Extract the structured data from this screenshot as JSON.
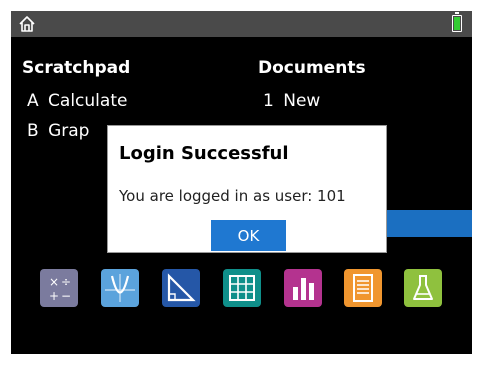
{
  "statusbar": {
    "home_icon": "home-icon",
    "battery_icon": "battery-icon",
    "battery_color": "#33cc33"
  },
  "scratchpad": {
    "heading": "Scratchpad",
    "items": [
      {
        "key": "A",
        "label": "Calculate"
      },
      {
        "key": "B",
        "label": "Grap"
      }
    ]
  },
  "documents": {
    "heading": "Documents",
    "items": [
      {
        "key": "1",
        "label": "New"
      }
    ]
  },
  "dialog": {
    "title": "Login Successful",
    "message": "You are logged in as user: 101",
    "ok_label": "OK"
  },
  "apps": [
    {
      "name": "calculator-icon",
      "color": "#7b7b9e"
    },
    {
      "name": "graphs-icon",
      "color": "#5ba3dc"
    },
    {
      "name": "geometry-icon",
      "color": "#2557a7"
    },
    {
      "name": "lists-spreadsheet-icon",
      "color": "#0f8f8a"
    },
    {
      "name": "data-statistics-icon",
      "color": "#b4338f"
    },
    {
      "name": "notes-icon",
      "color": "#f0962f"
    },
    {
      "name": "vernier-dataquest-icon",
      "color": "#8fc13e"
    }
  ],
  "accent": "#1f78d1"
}
